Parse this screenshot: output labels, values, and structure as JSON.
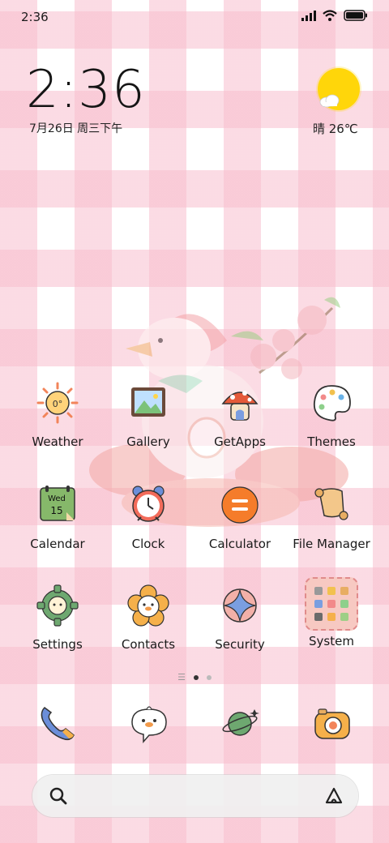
{
  "status_bar": {
    "time": "2:36"
  },
  "lockclock": {
    "time": "2:36",
    "date": "7月26日 周三下午"
  },
  "weather_widget": {
    "text": "晴 26℃"
  },
  "apps": [
    {
      "label": "Weather",
      "icon": "weather-icon"
    },
    {
      "label": "Gallery",
      "icon": "gallery-icon"
    },
    {
      "label": "GetApps",
      "icon": "getapps-icon"
    },
    {
      "label": "Themes",
      "icon": "themes-icon"
    },
    {
      "label": "Calendar",
      "icon": "calendar-icon",
      "icon_day": "Wed",
      "icon_date": "15"
    },
    {
      "label": "Clock",
      "icon": "clock-icon"
    },
    {
      "label": "Calculator",
      "icon": "calculator-icon"
    },
    {
      "label": "File Manager",
      "icon": "file-manager-icon"
    },
    {
      "label": "Settings",
      "icon": "settings-icon"
    },
    {
      "label": "Contacts",
      "icon": "contacts-icon"
    },
    {
      "label": "Security",
      "icon": "security-icon"
    },
    {
      "label": "System",
      "icon": "system-folder-icon"
    }
  ],
  "weather_icon_temp": "0°",
  "page_indicator": {
    "total": 2,
    "active": 0
  },
  "dock": [
    "phone-icon",
    "messages-icon",
    "browser-icon",
    "camera-icon"
  ],
  "colors": {
    "stripe_pink": "#f8becd",
    "sun_yellow": "#ffd60a",
    "calculator_orange": "#f57c2a"
  }
}
